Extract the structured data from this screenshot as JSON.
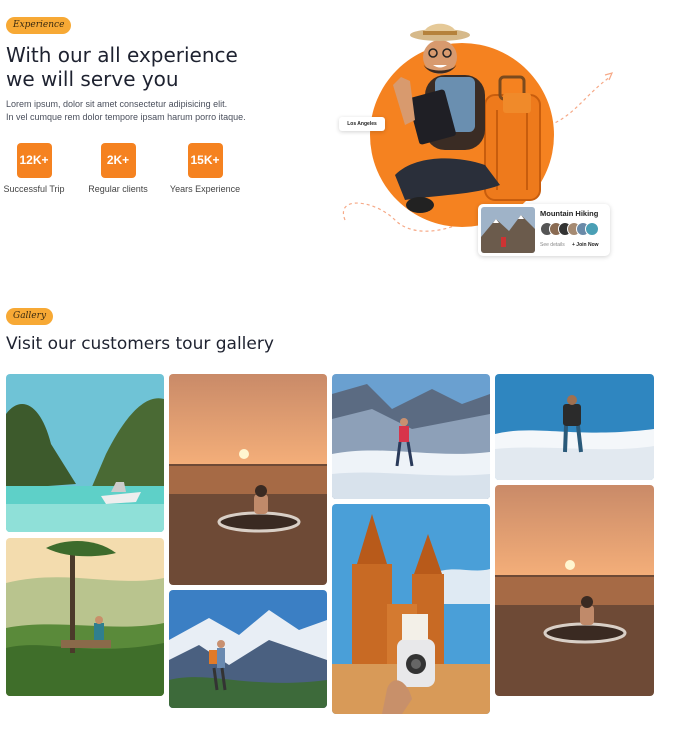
{
  "experience": {
    "tag": "Experience",
    "title_line1": "With our all experience",
    "title_line2": "we will serve you",
    "text_line1": "Lorem ipsum, dolor sit amet consectetur adipisicing elit.",
    "text_line2": "In vel cumque rem dolor tempore ipsam harum porro itaque.",
    "stats": [
      {
        "value": "12K+",
        "label": "Successful Trip"
      },
      {
        "value": "2K+",
        "label": "Regular clients"
      },
      {
        "value": "15K+",
        "label": "Years Experience"
      }
    ]
  },
  "hero": {
    "location_label": "Los Angeles",
    "card": {
      "title": "Mountain Hiking",
      "see_details": "See details",
      "join": "+ Join Now"
    }
  },
  "gallery": {
    "tag": "Gallery",
    "title": "Visit our customers tour gallery",
    "photos": [
      "lagoon-boat",
      "sunset-float",
      "snow-hiker",
      "mountain-backpacker",
      "treehouse-view",
      "mountain-trail",
      "church-camera",
      "sunset-float"
    ]
  },
  "colors": {
    "accent": "#f58220",
    "tag": "#f7a935"
  }
}
